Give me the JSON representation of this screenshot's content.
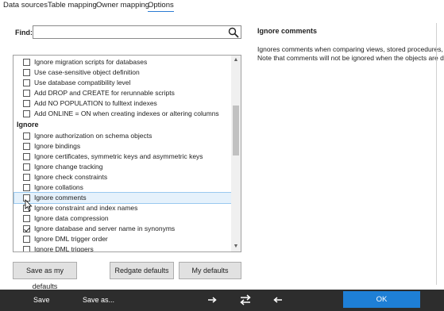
{
  "tabs": [
    {
      "label": "Data sources"
    },
    {
      "label": "Table mapping"
    },
    {
      "label": "Owner mapping"
    },
    {
      "label": "Options",
      "active": true
    }
  ],
  "find": {
    "label": "Find:",
    "value": ""
  },
  "options": {
    "items_top": [
      {
        "label": "Ignore migration scripts for databases",
        "checked": false
      },
      {
        "label": "Use case-sensitive object definition",
        "checked": false
      },
      {
        "label": "Use database compatibility level",
        "checked": false
      },
      {
        "label": "Add DROP and CREATE for rerunnable scripts",
        "checked": false
      },
      {
        "label": "Add NO POPULATION to fulltext indexes",
        "checked": false
      },
      {
        "label": "Add ONLINE = ON when creating indexes or altering columns",
        "checked": false
      }
    ],
    "ignore_heading": "Ignore",
    "items_ignore": [
      {
        "label": "Ignore authorization on schema objects",
        "checked": false
      },
      {
        "label": "Ignore bindings",
        "checked": false
      },
      {
        "label": "Ignore certificates, symmetric keys and asymmetric keys",
        "checked": false
      },
      {
        "label": "Ignore change tracking",
        "checked": false
      },
      {
        "label": "Ignore check constraints",
        "checked": false
      },
      {
        "label": "Ignore collations",
        "checked": false
      },
      {
        "label": "Ignore comments",
        "checked": false,
        "hover": true
      },
      {
        "label": "Ignore constraint and index names",
        "checked": false
      },
      {
        "label": "Ignore data compression",
        "checked": false
      },
      {
        "label": "Ignore database and server name in synonyms",
        "checked": true
      },
      {
        "label": "Ignore DML trigger order",
        "checked": false
      },
      {
        "label": "Ignore DML triggers",
        "checked": false
      }
    ]
  },
  "buttons": {
    "save_defaults": "Save as my defaults",
    "redgate_defaults": "Redgate defaults",
    "my_defaults": "My defaults"
  },
  "detail": {
    "title": "Ignore comments",
    "line1": "Ignores comments when comparing views, stored procedures, a",
    "line2": "Note that comments will not be ignored when the objects are d"
  },
  "footer": {
    "save": "Save",
    "save_as": "Save as...",
    "icons": [
      "arrow-right-icon",
      "swap-arrows-icon",
      "arrow-left-icon"
    ],
    "ok": "OK"
  },
  "colors": {
    "accent": "#1e7fd6",
    "footer_bg": "#2d2d2d",
    "hover_bg": "#e5f1fb"
  }
}
